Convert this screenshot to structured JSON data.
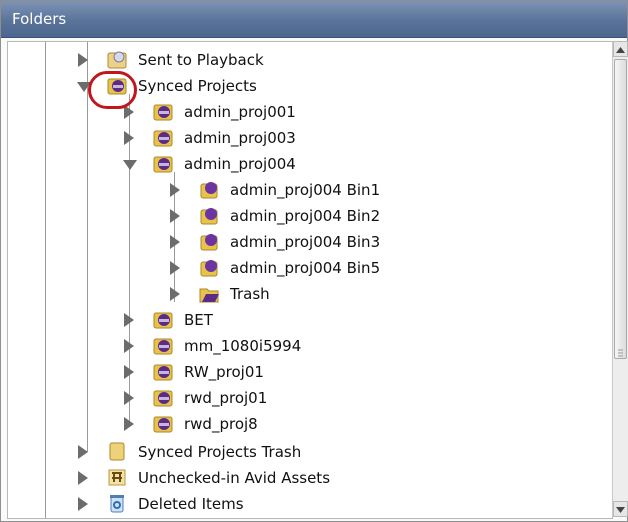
{
  "panel": {
    "title": "Folders"
  },
  "tree": [
    {
      "id": "sent-to-playback",
      "label": "Sent to Playback",
      "icon": "playback-folder-icon",
      "arrow": "right"
    },
    {
      "id": "synced-projects",
      "label": "Synced Projects",
      "icon": "project-folder-icon",
      "arrow": "down"
    },
    {
      "id": "admin-proj001",
      "label": "admin_proj001",
      "icon": "project-folder-icon",
      "arrow": "right"
    },
    {
      "id": "admin-proj003",
      "label": "admin_proj003",
      "icon": "project-folder-icon",
      "arrow": "right"
    },
    {
      "id": "admin-proj004",
      "label": "admin_proj004",
      "icon": "project-folder-icon",
      "arrow": "down"
    },
    {
      "id": "bin1",
      "label": "admin_proj004 Bin1",
      "icon": "bin-icon",
      "arrow": "right"
    },
    {
      "id": "bin2",
      "label": "admin_proj004 Bin2",
      "icon": "bin-icon",
      "arrow": "right"
    },
    {
      "id": "bin3",
      "label": "admin_proj004 Bin3",
      "icon": "bin-icon",
      "arrow": "right"
    },
    {
      "id": "bin5",
      "label": "admin_proj004 Bin5",
      "icon": "bin-icon",
      "arrow": "right"
    },
    {
      "id": "trash",
      "label": "Trash",
      "icon": "trash-folder-icon",
      "arrow": "right"
    },
    {
      "id": "bet",
      "label": "BET",
      "icon": "project-folder-icon",
      "arrow": "right"
    },
    {
      "id": "mm-1080i5994",
      "label": "mm_1080i5994",
      "icon": "project-folder-icon",
      "arrow": "right"
    },
    {
      "id": "rw-proj01",
      "label": "RW_proj01",
      "icon": "project-folder-icon",
      "arrow": "right"
    },
    {
      "id": "rwd-proj01",
      "label": "rwd_proj01",
      "icon": "project-folder-icon",
      "arrow": "right"
    },
    {
      "id": "rwd-proj8",
      "label": "rwd_proj8",
      "icon": "project-folder-icon",
      "arrow": "right"
    },
    {
      "id": "synced-projects-trash",
      "label": "Synced Projects Trash",
      "icon": "folder-icon",
      "arrow": "right"
    },
    {
      "id": "unchecked-in-avid-assets",
      "label": "Unchecked-in Avid Assets",
      "icon": "avid-assets-icon",
      "arrow": "right"
    },
    {
      "id": "deleted-items",
      "label": "Deleted Items",
      "icon": "recycle-bin-icon",
      "arrow": "right"
    }
  ],
  "colors": {
    "header": "#5a7399",
    "highlight_circle": "#c0161e",
    "project_icon": "#5b2c86",
    "folder_yellow": "#e8c24a"
  }
}
